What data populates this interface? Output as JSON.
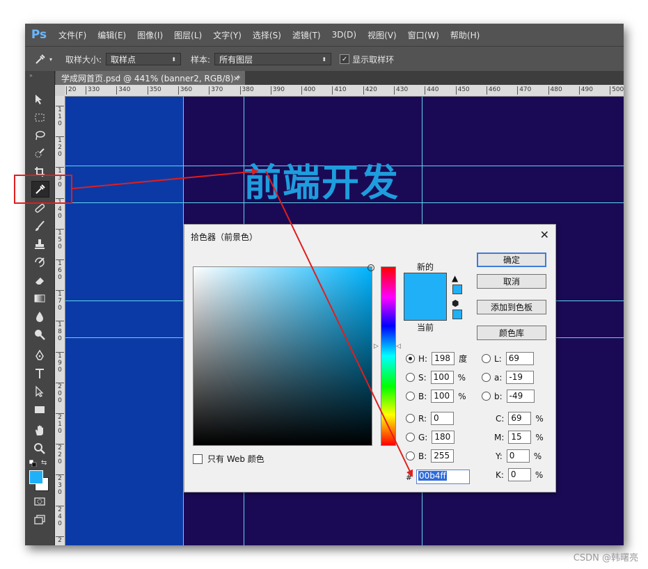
{
  "app": {
    "logo": "Ps",
    "menu": [
      "文件(F)",
      "编辑(E)",
      "图像(I)",
      "图层(L)",
      "文字(Y)",
      "选择(S)",
      "滤镜(T)",
      "3D(D)",
      "视图(V)",
      "窗口(W)",
      "帮助(H)"
    ]
  },
  "options_bar": {
    "tool_icon": "eyedropper-icon",
    "sample_size_label": "取样大小:",
    "sample_size_value": "取样点",
    "sample_label": "样本:",
    "sample_value": "所有图层",
    "show_ring_checked": true,
    "show_ring_label": "显示取样环"
  },
  "document": {
    "tab_title": "学成网首页.psd @ 441% (banner2, RGB/8) *",
    "tab_close": "×",
    "h_ruler": [
      "20",
      "330",
      "340",
      "350",
      "360",
      "370",
      "380",
      "390",
      "400",
      "410",
      "420",
      "430",
      "440",
      "450",
      "460",
      "470",
      "480",
      "490",
      "500"
    ],
    "v_ruler": [
      "1\n1\n0",
      "1\n2\n0",
      "1\n3\n0",
      "1\n4\n0",
      "1\n5\n0",
      "1\n6\n0",
      "1\n7\n0",
      "1\n8\n0",
      "1\n9\n0",
      "2\n0\n0",
      "2\n1\n0",
      "2\n2\n0",
      "2\n3\n0",
      "2\n4\n0",
      "2"
    ],
    "canvas_text": "前端开发",
    "canvas_text_color": "#1e9ddd",
    "canvas_bg": "#1a0a55",
    "canvas_left_bg": "#0b3aa6"
  },
  "toolbar": {
    "tools": [
      "move-icon",
      "marquee-icon",
      "lasso-icon",
      "quick-select-icon",
      "crop-icon",
      "eyedropper-icon",
      "healing-brush-icon",
      "brush-icon",
      "clone-stamp-icon",
      "history-brush-icon",
      "eraser-icon",
      "gradient-icon",
      "blur-icon",
      "dodge-icon",
      "pen-icon",
      "type-icon",
      "path-select-icon",
      "rectangle-icon",
      "hand-icon",
      "zoom-icon"
    ],
    "selected_tool": "eyedropper-icon",
    "foreground_color": "#1fb0f8",
    "background_color": "#ffffff"
  },
  "color_picker": {
    "title": "拾色器（前景色）",
    "close": "✕",
    "new_label": "新的",
    "current_label": "当前",
    "new_color": "#1fb0f8",
    "current_color": "#1fb0f8",
    "buttons": {
      "ok": "确定",
      "cancel": "取消",
      "add_to_swatches": "添加到色板",
      "color_libraries": "颜色库"
    },
    "hsb": {
      "h_label": "H:",
      "h_value": "198",
      "h_unit": "度",
      "s_label": "S:",
      "s_value": "100",
      "s_unit": "%",
      "b_label": "B:",
      "b_value": "100",
      "b_unit": "%",
      "selected": "H"
    },
    "lab": {
      "l_label": "L:",
      "l_value": "69",
      "a_label": "a:",
      "a_value": "-19",
      "b_label": "b:",
      "b_value": "-49"
    },
    "rgb": {
      "r_label": "R:",
      "r_value": "0",
      "g_label": "G:",
      "g_value": "180",
      "b_label": "B:",
      "b_value": "255"
    },
    "cmyk": {
      "c_label": "C:",
      "c_value": "69",
      "m_label": "M:",
      "m_value": "15",
      "y_label": "Y:",
      "y_value": "0",
      "k_label": "K:",
      "k_value": "0",
      "unit": "%"
    },
    "hex_label": "#",
    "hex_value": "00b4ff",
    "web_only_label": "只有 Web 颜色",
    "web_only_checked": false
  },
  "annotation": {
    "arrow_color": "#e01e1e"
  },
  "watermark": "CSDN @韩曙亮"
}
